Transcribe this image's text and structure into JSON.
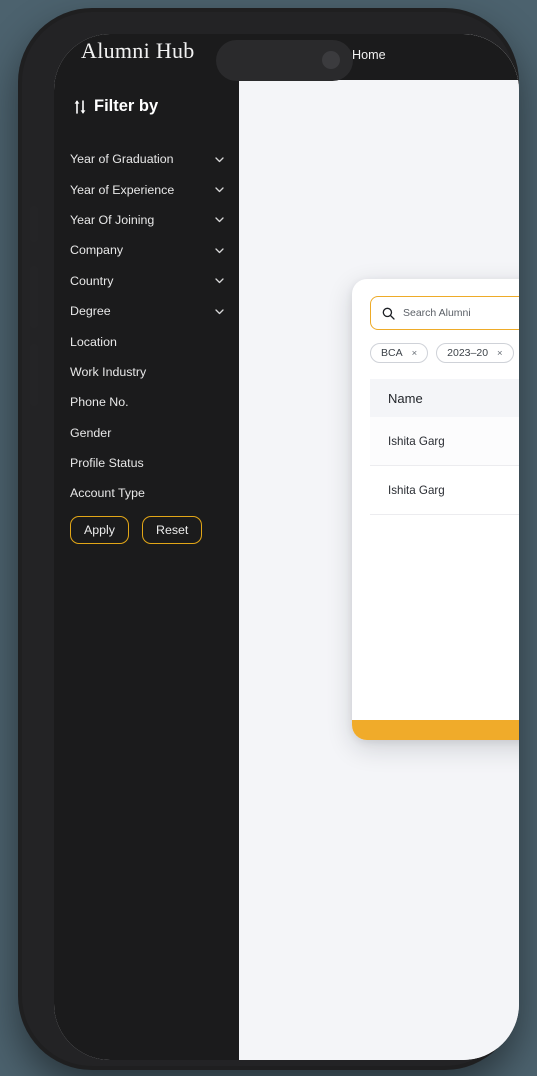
{
  "app": {
    "brand": "Alumni Hub",
    "accent_gold": "#e2a617",
    "footer_gold": "#f0ab2a",
    "sidebar_bg": "#1b1b1c",
    "screen_bg": "#f4f5f8",
    "page_bg": "#4c626e"
  },
  "topnav": {
    "home_label": "Home"
  },
  "sidebar": {
    "filter_heading": "Filter by",
    "filter_icon": "sort-filter-icon",
    "items": [
      {
        "label": "Year of Graduation",
        "expandable": true
      },
      {
        "label": "Year of Experience",
        "expandable": true
      },
      {
        "label": "Year Of Joining",
        "expandable": true
      },
      {
        "label": "Company",
        "expandable": true
      },
      {
        "label": "Country",
        "expandable": true
      },
      {
        "label": "Degree",
        "expandable": true
      },
      {
        "label": "Location",
        "expandable": false
      },
      {
        "label": "Work Industry",
        "expandable": false
      },
      {
        "label": "Phone No.",
        "expandable": false
      },
      {
        "label": "Gender",
        "expandable": false
      },
      {
        "label": "Profile Status",
        "expandable": false
      },
      {
        "label": "Account Type",
        "expandable": false
      }
    ],
    "apply_label": "Apply",
    "reset_label": "Reset"
  },
  "card": {
    "search": {
      "icon": "search-icon",
      "placeholder": "Search Alumni",
      "value": ""
    },
    "chips": [
      {
        "label": "BCA",
        "remove": "×"
      },
      {
        "label": "2023–20",
        "remove": "×"
      }
    ],
    "table": {
      "columns": [
        "Name"
      ],
      "rows": [
        {
          "name": "Ishita Garg"
        },
        {
          "name": "Ishita Garg"
        }
      ]
    }
  }
}
